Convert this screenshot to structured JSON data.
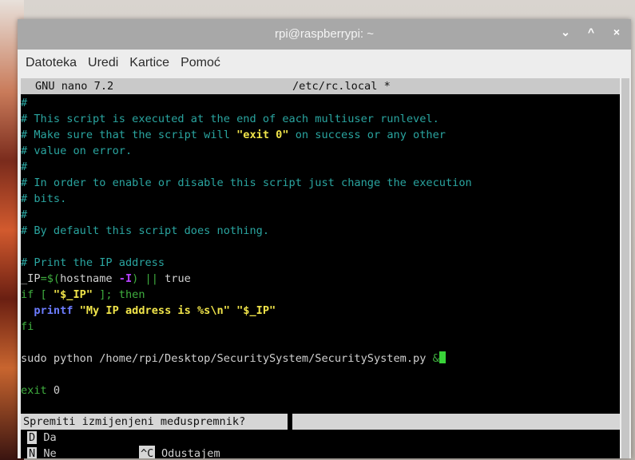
{
  "window": {
    "title": "rpi@raspberrypi: ~",
    "controls": [
      "⌄",
      "^",
      "×"
    ]
  },
  "menu": [
    "Datoteka",
    "Uredi",
    "Kartice",
    "Pomoć"
  ],
  "nano": {
    "version": "GNU nano 7.2",
    "filename": "/etc/rc.local *"
  },
  "code": {
    "l1": "#",
    "l2": "# This script is executed at the end of each multiuser runlevel.",
    "l3a": "# Make sure that the script will ",
    "l3b": "\"exit 0\"",
    "l3c": " on success or any other",
    "l4": "# value on error.",
    "l5": "#",
    "l6": "# In order to enable or disable this script just change the execution",
    "l7": "# bits.",
    "l8": "#",
    "l9": "# By default this script does nothing.",
    "l11": "# Print the IP address",
    "l12a": "_IP",
    "l12b": "=$(",
    "l12c": "hostname ",
    "l12d": "-I",
    "l12e": ") || ",
    "l12f": "true",
    "l13a": "if [ ",
    "l13b": "\"$_IP\"",
    "l13c": " ]; then",
    "l14a": "  printf ",
    "l14b": "\"My IP address is %s\\n\" \"$_IP\"",
    "l15": "fi",
    "l17a": "sudo python /home/rpi/Desktop/SecuritySystem/SecuritySystem.py ",
    "l17b": "&",
    "l19a": "exit ",
    "l19b": "0"
  },
  "prompt": {
    "question": "Spremiti izmijenjeni međuspremnik?",
    "yes_key": "D",
    "yes_label": "Da",
    "no_key": "N",
    "no_label": "Ne",
    "cancel_key": "^C",
    "cancel_label": "Odustajem"
  }
}
